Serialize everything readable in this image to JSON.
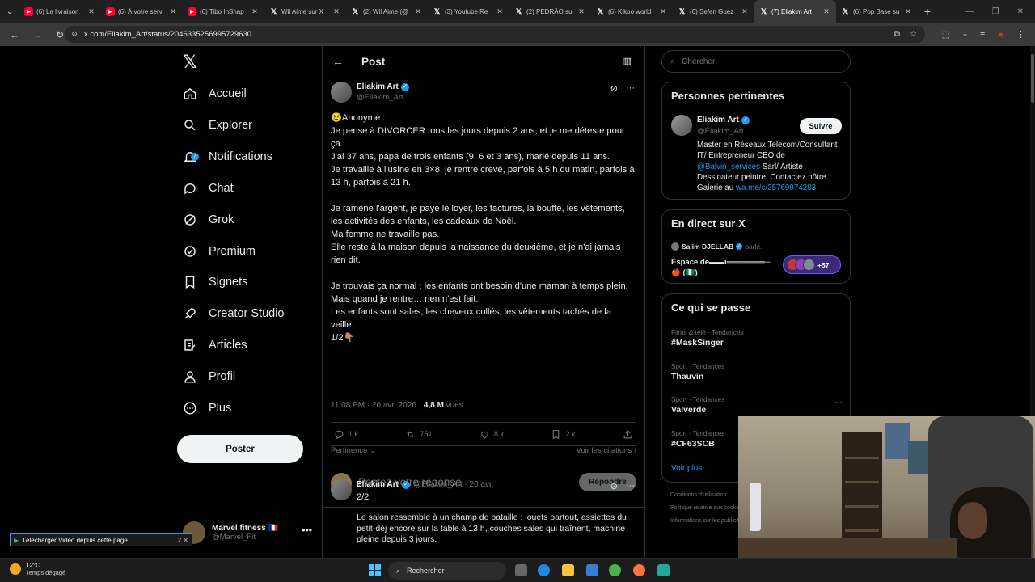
{
  "browser": {
    "tabs": [
      {
        "title": "(6) La livraison",
        "icon": "youtube-icon"
      },
      {
        "title": "(6) À votre serv",
        "icon": "youtube-icon"
      },
      {
        "title": "(6) Tibo InShap",
        "icon": "youtube-icon"
      },
      {
        "title": "Wil Aime sur X",
        "icon": "x-icon"
      },
      {
        "title": "(2) Wil Aime (@",
        "icon": "x-icon"
      },
      {
        "title": "(3) Youtube Re",
        "icon": "x-icon"
      },
      {
        "title": "(2) PEDRÃO su",
        "icon": "x-icon"
      },
      {
        "title": "(6) Kikoo world",
        "icon": "x-icon"
      },
      {
        "title": "(6) Sefen Guez",
        "icon": "x-icon"
      },
      {
        "title": "(7) Eliakim Art",
        "icon": "x-icon",
        "active": true
      },
      {
        "title": "(6) Pop Base su",
        "icon": "x-icon"
      }
    ],
    "url": "x.com/Eliakim_Art/status/2046335256995729630"
  },
  "nav": {
    "items": [
      {
        "label": "Accueil",
        "icon": "home-icon"
      },
      {
        "label": "Explorer",
        "icon": "search-icon"
      },
      {
        "label": "Notifications",
        "icon": "bell-icon",
        "badge": "7"
      },
      {
        "label": "Chat",
        "icon": "chat-icon"
      },
      {
        "label": "Grok",
        "icon": "grok-icon"
      },
      {
        "label": "Premium",
        "icon": "premium-icon"
      },
      {
        "label": "Signets",
        "icon": "bookmark-icon"
      },
      {
        "label": "Creator Studio",
        "icon": "rocket-icon"
      },
      {
        "label": "Articles",
        "icon": "article-icon"
      },
      {
        "label": "Profil",
        "icon": "profile-icon"
      },
      {
        "label": "Plus",
        "icon": "more-circle-icon"
      }
    ],
    "post_button": "Poster",
    "account": {
      "name": "Marvel fitness 🇫🇷",
      "handle": "@Marvel_Fit"
    }
  },
  "main": {
    "header_title": "Post",
    "tweet": {
      "author": "Eliakim Art",
      "handle": "@Eliakim_Art",
      "lines": [
        "😢Anonyme :",
        "Je pense à DIVORCER tous les jours depuis 2 ans, et je me déteste pour ça.",
        "J'ai 37 ans, papa de trois enfants (9, 6 et 3 ans), marié depuis 11 ans.",
        "Je travaille à l'usine en 3×8, je rentre crevé, parfois à 5 h du matin, parfois à 13 h, parfois à 21 h.",
        "",
        "Je ramène l'argent, je paye le loyer, les factures, la bouffe, les vêtements, les activités des enfants, les cadeaux de Noël.",
        "Ma femme ne travaille pas.",
        "Elle reste à la maison depuis la naissance du deuxième, et je n'ai jamais rien dit.",
        "",
        "Je trouvais ça normal : les enfants ont besoin d'une maman à temps plein.",
        "Mais quand je rentre… rien n'est fait.",
        "Les enfants sont sales, les cheveux collés, les vêtements tachés de la veille.",
        "1/2👇🏽"
      ],
      "time": "11:08 PM · 20 avr. 2026 · ",
      "views_count": "4,8 M",
      "views_label": " vues",
      "stats": {
        "replies": "1 k",
        "reposts": "751",
        "likes": "8 k",
        "bookmarks": "2 k"
      },
      "sort_label": "Pertinence ⌄",
      "quotes_label": "Voir les citations ›"
    },
    "reply": {
      "placeholder": "Postez votre réponse",
      "button": "Répondre"
    },
    "tweet2": {
      "author": "Eliakim Art",
      "handle": "@Eliakim_Art · 20 avr.",
      "number": "2/2",
      "text": "Le salon ressemble à un champ de bataille : jouets partout, assiettes du petit-déj encore sur la table à 13 h, couches sales qui traînent, machine pleine depuis 3 jours."
    }
  },
  "right": {
    "search_placeholder": "Chercher",
    "relevant": {
      "title": "Personnes pertinentes",
      "name": "Eliakim Art",
      "handle": "@Eliakim_Art",
      "follow": "Suivre",
      "bio_1": "Master en Réseaux Telecom/Consultant IT/ Entrepreneur CEO de ",
      "bio_link1": "@Balvin_services",
      "bio_2": " Sarl/ Artiste Dessinateur peintre. Contactez nôtre Galerie au ",
      "bio_link2": "wa.me/c/25769974283"
    },
    "live": {
      "title": "En direct sur X",
      "host": "Salim DJELLAB",
      "speaking": "parle.",
      "space_title": "Espace de▬▬ι═══════─ 🍎 (🇳🇬)",
      "count": "+57"
    },
    "trends": {
      "title": "Ce qui se passe",
      "items": [
        {
          "cat": "Films & télé · Tendances",
          "name": "#MaskSinger"
        },
        {
          "cat": "Sport · Tendances",
          "name": "Thauvin"
        },
        {
          "cat": "Sport · Tendances",
          "name": "Valverde"
        },
        {
          "cat": "Sport · Tendances",
          "name": "#CF63SCB"
        }
      ],
      "see_more": "Voir plus"
    },
    "footer": [
      "Conditions d'utilisation",
      "Politique relative aux cookies",
      "Informations sur les publicités"
    ]
  },
  "overlay": {
    "download_bar": "Télécharger Vidéo depuis cette page",
    "download_count": "2"
  },
  "taskbar": {
    "temp": "12°C",
    "weather": "Temps dégagé",
    "search": "Rechercher"
  }
}
